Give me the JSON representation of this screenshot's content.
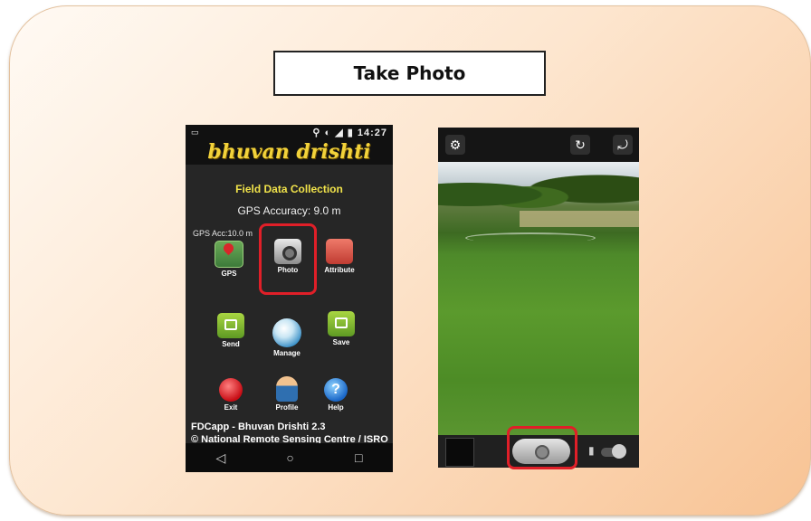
{
  "title": "Take Photo",
  "phone_left": {
    "status_time": "14:27",
    "app_banner": "bhuvan drishti",
    "heading": "Field Data Collection",
    "gps_accuracy": "GPS Accuracy: 9.0 m",
    "gps_acc_small": "GPS Acc:10.0 m",
    "icons": {
      "gps": "GPS",
      "photo": "Photo",
      "attribute": "Attribute",
      "send": "Send",
      "manage": "Manage",
      "save": "Save",
      "exit": "Exit",
      "profile": "Profile",
      "help": "Help"
    },
    "footer_line1": "FDCapp - Bhuvan Drishti 2.3",
    "footer_line2": "© National Remote Sensing Centre / ISRO",
    "nav": {
      "back": "◁",
      "home": "○",
      "recent": "□"
    }
  },
  "phone_right": {
    "settings_icon": "gear-icon",
    "highlight_color": "#e01f28"
  }
}
